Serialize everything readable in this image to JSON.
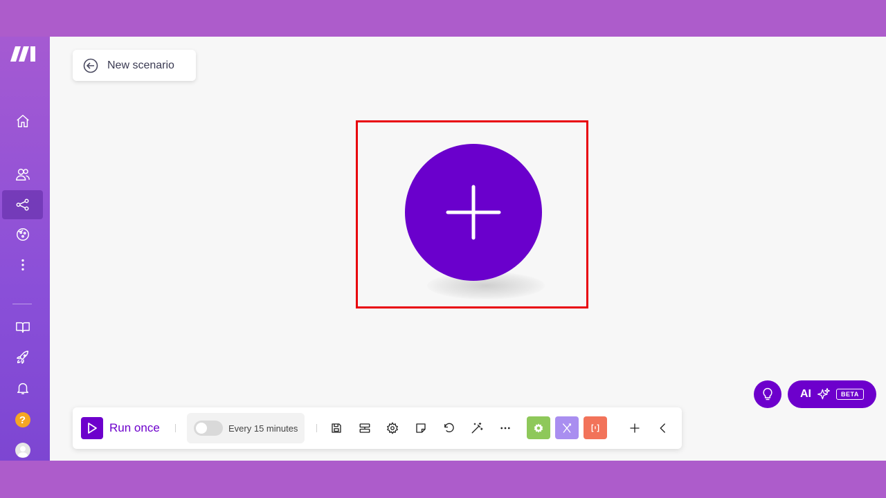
{
  "header": {
    "back_label": "New scenario"
  },
  "sidebar": {
    "items": [
      {
        "name": "home",
        "icon": "home-icon"
      },
      {
        "name": "team",
        "icon": "users-icon"
      },
      {
        "name": "scenarios",
        "icon": "share-icon",
        "active": true
      },
      {
        "name": "templates",
        "icon": "globe-icon"
      },
      {
        "name": "more",
        "icon": "more-vertical-icon"
      },
      {
        "name": "docs",
        "icon": "book-icon"
      },
      {
        "name": "whats-new",
        "icon": "rocket-icon"
      },
      {
        "name": "notifications",
        "icon": "bell-icon"
      },
      {
        "name": "help",
        "icon": "help-icon",
        "badge": "?"
      },
      {
        "name": "profile",
        "icon": "avatar-icon"
      }
    ]
  },
  "canvas": {
    "add_module_icon": "plus-icon"
  },
  "assistant": {
    "ai_label": "AI",
    "ai_badge": "BETA"
  },
  "toolbar": {
    "run_label": "Run once",
    "schedule_label": "Every 15 minutes",
    "schedule_enabled": false,
    "tools": [
      "save-icon",
      "align-icon",
      "gear-icon",
      "note-icon",
      "undo-icon",
      "magic-wand-icon",
      "more-horizontal-icon"
    ],
    "modules": [
      {
        "name": "tools",
        "color": "#8ec85a"
      },
      {
        "name": "flow-control",
        "color": "#a98ef0"
      },
      {
        "name": "text-parser",
        "color": "#f2735a"
      }
    ]
  },
  "colors": {
    "brand": "#6d00cc",
    "highlight": "#e8000b",
    "sidebar": "#a55ad2"
  }
}
